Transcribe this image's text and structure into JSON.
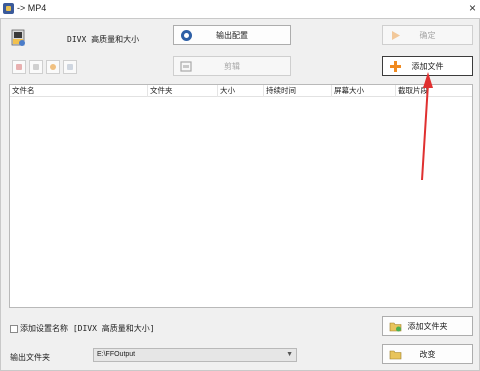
{
  "window": {
    "title": "-> MP4",
    "close_glyph": "×"
  },
  "profile": {
    "label": "DIVX 高质量和大小",
    "icon": "video-profile-icon"
  },
  "toolbar": {
    "output_config_label": "输出配置",
    "clip_label": "剪辑",
    "confirm_label": "确定",
    "add_file_label": "添加文件"
  },
  "file_list": {
    "columns": [
      "文件名",
      "文件夹",
      "大小",
      "持续时间",
      "屏幕大小",
      "截取片段"
    ],
    "rows": []
  },
  "bottom": {
    "add_profile_name_label": "添加设置名称 [DIVX 高质量和大小]",
    "add_profile_name_checked": false,
    "add_folder_label": "添加文件夹",
    "output_folder_label": "输出文件夹",
    "output_folder_value": "E:\\FFOutput",
    "change_label": "改变"
  },
  "colors": {
    "annotation_arrow": "#e03030",
    "add_icon": "#f08a20"
  }
}
